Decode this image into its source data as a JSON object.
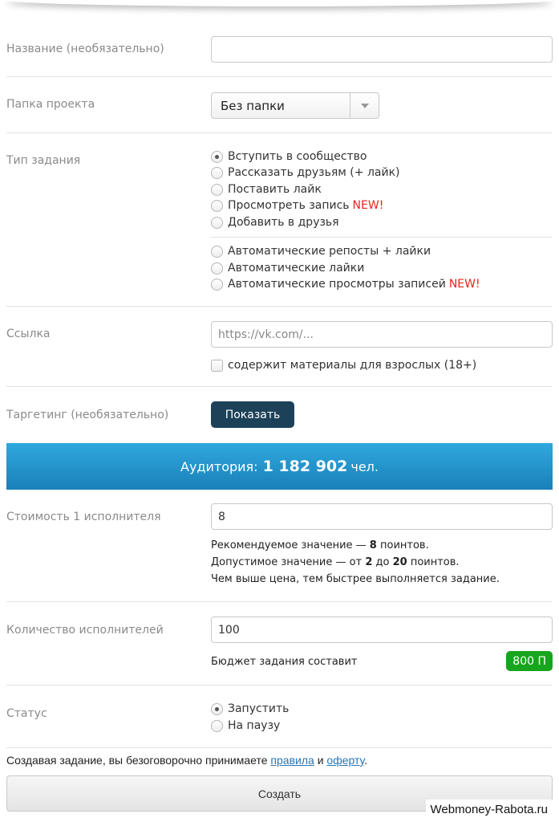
{
  "name_field": {
    "label": "Название (необязательно)",
    "value": ""
  },
  "project_folder": {
    "label": "Папка проекта",
    "selected": "Без папки"
  },
  "task_type": {
    "label": "Тип задания",
    "options_group1": [
      {
        "label": "Вступить в сообщество",
        "checked": true,
        "new": ""
      },
      {
        "label": "Рассказать друзьям (+ лайк)",
        "checked": false,
        "new": ""
      },
      {
        "label": "Поставить лайк",
        "checked": false,
        "new": ""
      },
      {
        "label": "Просмотреть запись",
        "checked": false,
        "new": "NEW!"
      },
      {
        "label": "Добавить в друзья",
        "checked": false,
        "new": ""
      }
    ],
    "options_group2": [
      {
        "label": "Автоматические репосты + лайки",
        "checked": false,
        "new": ""
      },
      {
        "label": "Автоматические лайки",
        "checked": false,
        "new": ""
      },
      {
        "label": "Автоматические просмотры записей",
        "checked": false,
        "new": "NEW!"
      }
    ]
  },
  "link": {
    "label": "Ссылка",
    "placeholder": "https://vk.com/...",
    "adult_checkbox_label": "содержит материалы для взрослых (18+)"
  },
  "targeting": {
    "label": "Таргетинг (необязательно)",
    "button_label": "Показать"
  },
  "audience": {
    "prefix": "Аудитория:",
    "count": "1 182 902",
    "suffix": "чел."
  },
  "cost": {
    "label": "Стоимость 1 исполнителя",
    "value": "8",
    "recommended_prefix": "Рекомендуемое значение —",
    "recommended_value": "8",
    "recommended_suffix": "поинтов.",
    "allowed_prefix": "Допустимое значение — от",
    "allowed_min": "2",
    "allowed_mid": "до",
    "allowed_max": "20",
    "allowed_suffix": "поинтов.",
    "note": "Чем выше цена, тем быстрее выполняется задание."
  },
  "performers": {
    "label": "Количество исполнителей",
    "value": "100",
    "budget_label": "Бюджет задания составит",
    "budget_value": "800 П"
  },
  "status": {
    "label": "Статус",
    "options": [
      {
        "label": "Запустить",
        "checked": true
      },
      {
        "label": "На паузу",
        "checked": false
      }
    ]
  },
  "terms": {
    "text": "Создавая задание, вы безоговорочно принимаете",
    "rules_link": "правила",
    "and": "и",
    "offer_link": "оферту",
    "end": "."
  },
  "create_button": "Создать",
  "watermark": "Webmoney-Rabota.ru",
  "colors": {
    "accent_dark": "#1c4158",
    "audience_bar": "#1a80b9",
    "badge_green": "#17a51e",
    "new_red": "#e8231a",
    "link": "#2a76b5"
  }
}
